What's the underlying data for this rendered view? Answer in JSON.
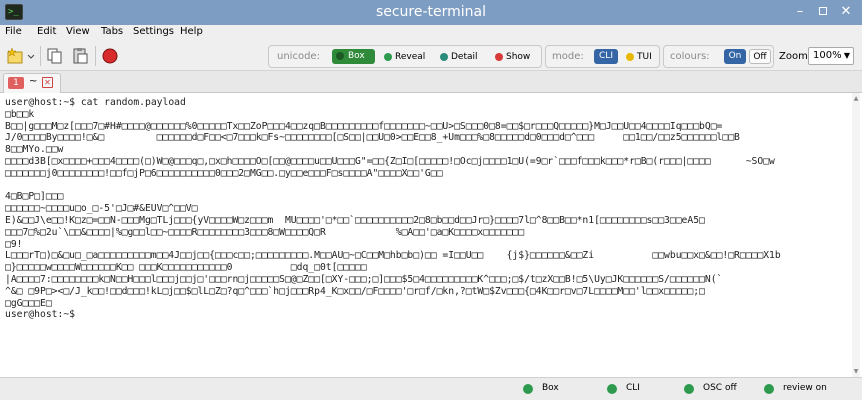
{
  "window": {
    "title": "secure-terminal",
    "app_icon": "terminal-icon",
    "icon_glyph": ">_"
  },
  "menu": [
    "File",
    "Edit",
    "View",
    "Tabs",
    "Settings",
    "Help"
  ],
  "toolbar": {
    "unicode": {
      "label": "unicode:",
      "options": [
        "Box",
        "Reveal",
        "Detail",
        "Show"
      ],
      "active": "Box"
    },
    "mode": {
      "label": "mode:",
      "options": [
        "CLI",
        "TUI"
      ],
      "active": "CLI"
    },
    "colours": {
      "label": "colours:",
      "options": [
        "On",
        "Off"
      ],
      "active": "On"
    },
    "zoom": {
      "label": "Zoom",
      "value": "100%"
    },
    "colors": {
      "accent": "#3465a4",
      "green": "#2d9a4e",
      "teal": "#2a8c7a",
      "red": "#d83a3a",
      "yellow": "#e8b800"
    }
  },
  "tabs": [
    {
      "number": "1",
      "title": "~"
    }
  ],
  "terminal": {
    "prompt": "user@host:~$ ",
    "command": "cat random.payload",
    "final_prompt": "user@host:~$"
  },
  "status": [
    {
      "label": "Box",
      "color": "#2d9a4e"
    },
    {
      "label": "CLI",
      "color": "#2d9a4e"
    },
    {
      "label": "OSC off",
      "color": "#2d9a4e"
    },
    {
      "label": "review on",
      "color": "#2d9a4e"
    }
  ]
}
